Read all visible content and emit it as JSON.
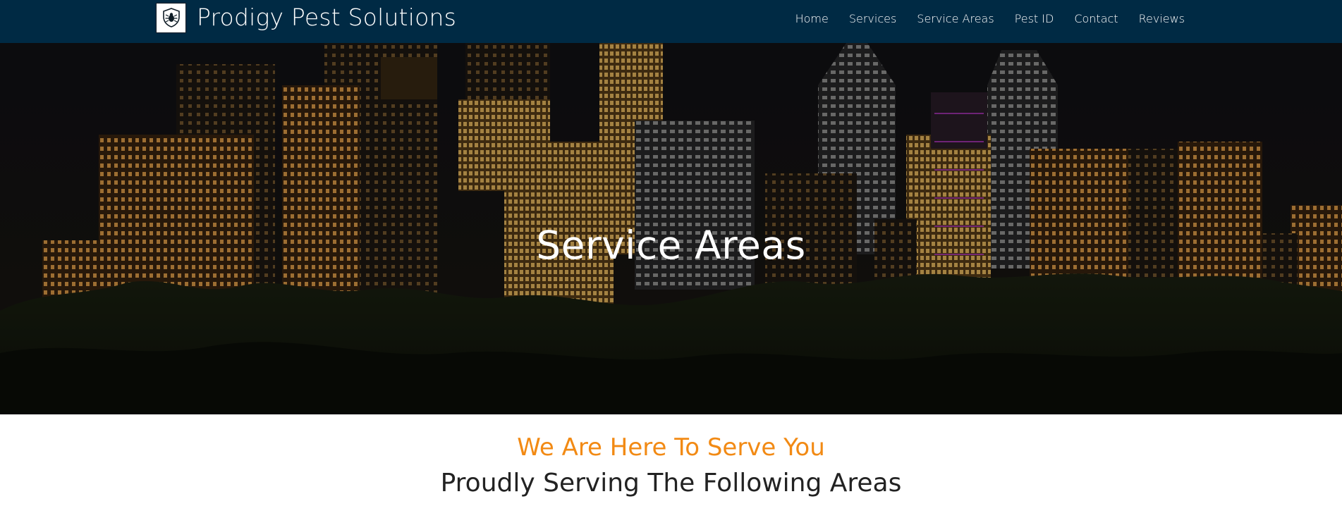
{
  "header": {
    "brand_name": "Prodigy Pest Solutions",
    "logo_icon": "bug-shield-icon",
    "background_color": "#002a44",
    "nav": [
      {
        "label": "Home"
      },
      {
        "label": "Services"
      },
      {
        "label": "Service Areas"
      },
      {
        "label": "Pest ID"
      },
      {
        "label": "Contact"
      },
      {
        "label": "Reviews"
      }
    ]
  },
  "hero": {
    "title": "Service Areas",
    "background": "city-skyline-night-image"
  },
  "intro": {
    "kicker": "We Are Here To Serve You",
    "heading": "Proudly Serving The Following Areas",
    "kicker_color": "#f28a14",
    "heading_color": "#222222"
  }
}
